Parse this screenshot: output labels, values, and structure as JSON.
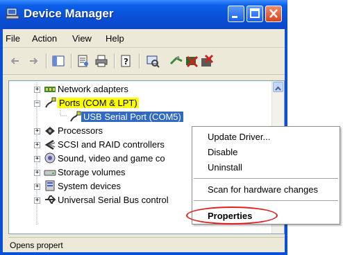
{
  "window": {
    "title": "Device Manager"
  },
  "menubar": {
    "items": [
      "File",
      "Action",
      "View",
      "Help"
    ]
  },
  "toolbar": {
    "icons": [
      "back-icon",
      "forward-icon",
      "console-tree-icon",
      "properties-icon",
      "print-icon",
      "help-icon",
      "scan-hardware-icon",
      "update-driver-icon",
      "uninstall-icon",
      "disable-icon"
    ]
  },
  "tree": {
    "items": [
      {
        "label": "Network adapters",
        "expander": "+"
      },
      {
        "label": "Ports (COM & LPT)",
        "expander": "−"
      },
      {
        "label": "USB Serial Port (COM5)"
      },
      {
        "label": "Processors",
        "expander": "+"
      },
      {
        "label": "SCSI and RAID controllers",
        "expander": "+"
      },
      {
        "label": "Sound, video and game co",
        "expander": "+"
      },
      {
        "label": "Storage volumes",
        "expander": "+"
      },
      {
        "label": "System devices",
        "expander": "+"
      },
      {
        "label": "Universal Serial Bus control",
        "expander": "+"
      }
    ]
  },
  "context_menu": {
    "items": [
      "Update Driver...",
      "Disable",
      "Uninstall",
      "Scan for hardware changes",
      "Properties"
    ]
  },
  "status": {
    "text": "Opens propert"
  },
  "colors": {
    "title_bar": "#0a50d8",
    "highlight": "#ffff00",
    "selection": "#316ac5",
    "annotation": "#e02020"
  }
}
